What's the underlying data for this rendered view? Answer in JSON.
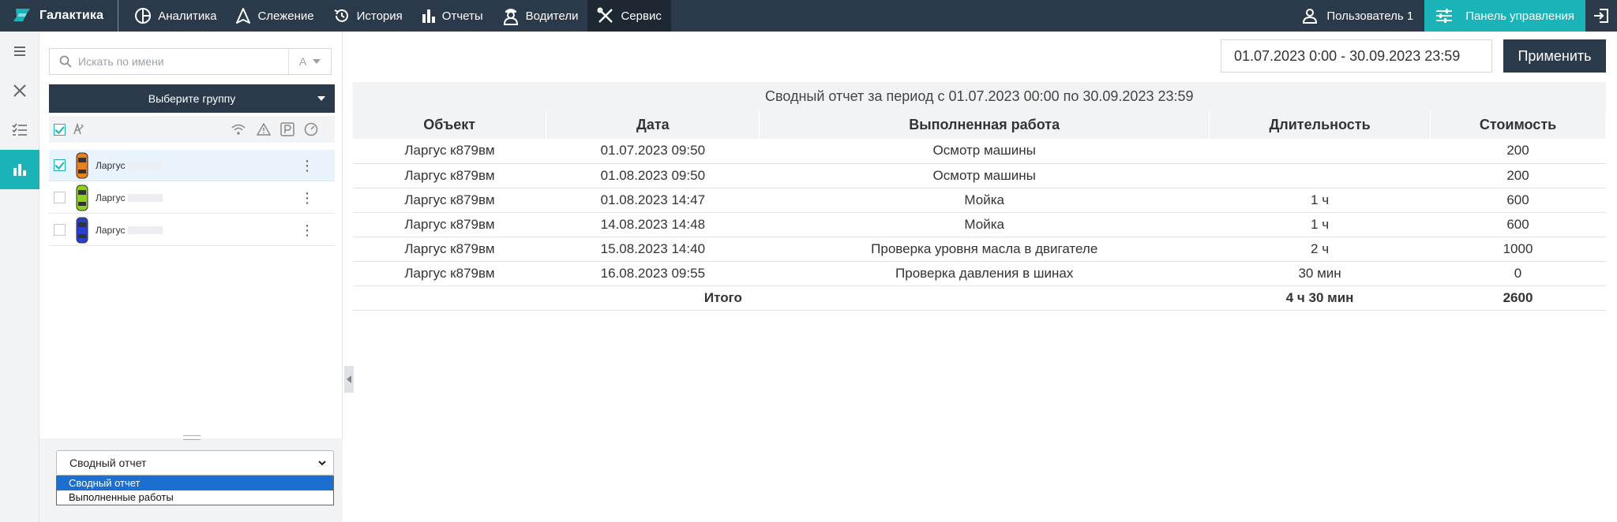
{
  "app": {
    "logo_text": "Галактика",
    "nav": [
      {
        "label": "Аналитика",
        "icon": "analytics-icon"
      },
      {
        "label": "Слежение",
        "icon": "tracking-icon"
      },
      {
        "label": "История",
        "icon": "history-icon"
      },
      {
        "label": "Отчеты",
        "icon": "reports-icon"
      },
      {
        "label": "Водители",
        "icon": "drivers-icon"
      },
      {
        "label": "Сервис",
        "icon": "service-icon",
        "active": true
      }
    ],
    "user_label": "Пользователь 1",
    "panel_label": "Панель управления",
    "accent_color": "#1ab3b8",
    "header_color": "#2b3a4a"
  },
  "sidebar": {
    "search_placeholder": "Искать по имени",
    "sort_label": "А",
    "group_button": "Выберите группу",
    "vehicles": [
      {
        "name": "Ларгус",
        "color": "#e8821e",
        "checked": true
      },
      {
        "name": "Ларгус",
        "color": "#8ed11c",
        "checked": false
      },
      {
        "name": "Ларгус",
        "color": "#2a3fd1",
        "checked": false
      }
    ],
    "report_select": {
      "value": "Сводный отчет",
      "options": [
        "Сводный отчет",
        "Выполненные работы"
      ],
      "highlighted": "Сводный отчет"
    }
  },
  "main": {
    "date_range": "01.07.2023 0:00 - 30.09.2023 23:59",
    "apply_label": "Применить",
    "report": {
      "caption": "Сводный отчет за период с 01.07.2023 00:00 по 30.09.2023 23:59",
      "columns": [
        "Объект",
        "Дата",
        "Выполненная работа",
        "Длительность",
        "Стоимость"
      ],
      "rows": [
        [
          "Ларгус к879вм",
          "01.07.2023 09:50",
          "Осмотр машины",
          "",
          "200"
        ],
        [
          "Ларгус к879вм",
          "01.08.2023 09:50",
          "Осмотр машины",
          "",
          "200"
        ],
        [
          "Ларгус к879вм",
          "01.08.2023 14:47",
          "Мойка",
          "1 ч",
          "600"
        ],
        [
          "Ларгус к879вм",
          "14.08.2023 14:48",
          "Мойка",
          "1 ч",
          "600"
        ],
        [
          "Ларгус к879вм",
          "15.08.2023 14:40",
          "Проверка уровня масла в двигателе",
          "2 ч",
          "1000"
        ],
        [
          "Ларгус к879вм",
          "16.08.2023 09:55",
          "Проверка давления в шинах",
          "30 мин",
          "0"
        ]
      ],
      "total": {
        "label": "Итого",
        "duration": "4 ч 30 мин",
        "cost": "2600"
      }
    }
  }
}
